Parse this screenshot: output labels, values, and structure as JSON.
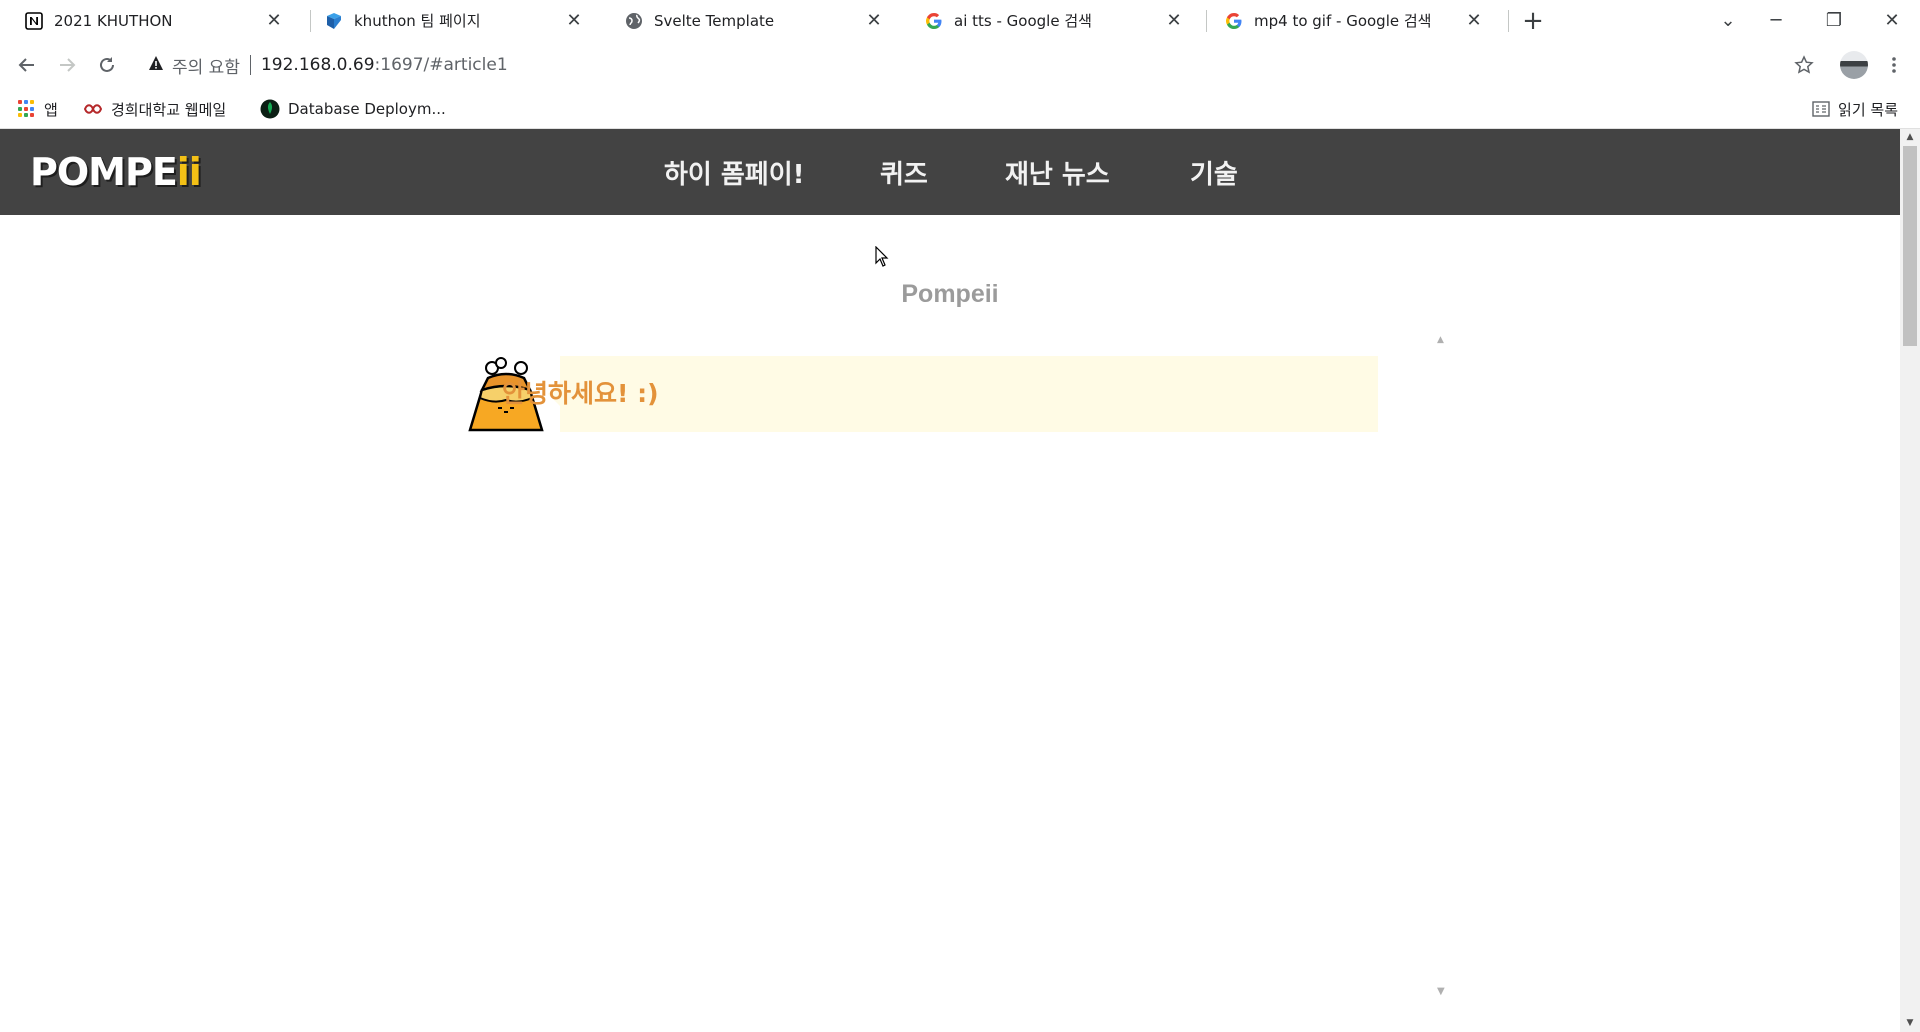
{
  "browser": {
    "tabs": [
      {
        "title": "2021 KHUTHON",
        "icon": "notion-icon"
      },
      {
        "title": "khuthon 팀 페이지",
        "icon": "cube-icon"
      },
      {
        "title": "Svelte Template",
        "icon": "globe-icon"
      },
      {
        "title": "ai tts - Google 검색",
        "icon": "google-icon"
      },
      {
        "title": "mp4 to gif - Google 검색",
        "icon": "google-icon"
      }
    ],
    "new_tab_glyph": "+",
    "close_glyph": "✕",
    "tab_list_glyph": "⌄",
    "minimize_glyph": "─",
    "restore_glyph": "❐",
    "window_close_glyph": "✕",
    "security_label": "주의 요함",
    "url_host": "192.168.0.69",
    "url_rest": ":1697/#article1",
    "bookmarks": [
      {
        "label": "앱",
        "icon": "apps-grid-icon"
      },
      {
        "label": "경희대학교 웹메일",
        "icon": "khu-logo-icon"
      },
      {
        "label": "Database Deploym...",
        "icon": "mongodb-leaf-icon"
      }
    ],
    "reading_list_label": "읽기 목록"
  },
  "site": {
    "logo_main": "POMPE",
    "logo_accent": "ii",
    "nav": [
      "하이 폼페이!",
      "퀴즈",
      "재난 뉴스",
      "기술"
    ],
    "page_title": "Pompeii",
    "greeting": "안녕하세요! :)"
  },
  "colors": {
    "nav_bg": "#434343",
    "bubble_bg": "#fffbe5",
    "greeting_text": "#e3923a",
    "title_text": "#9b9b9b",
    "logo_accent": "#f3c016"
  }
}
